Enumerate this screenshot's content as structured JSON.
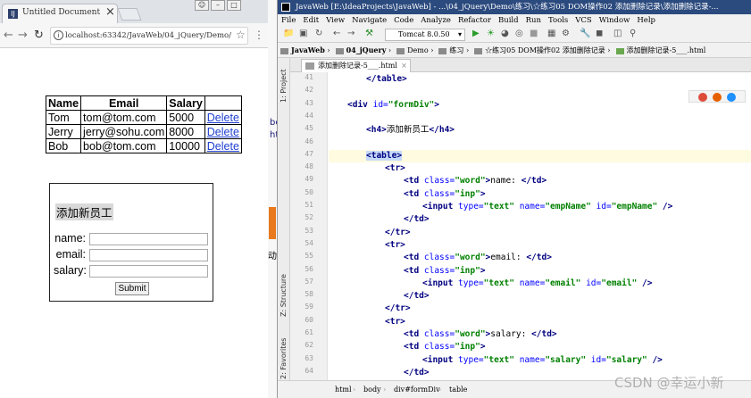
{
  "browser": {
    "tab_title": "Untitled Document",
    "tab_close": "×",
    "url": "localhost:63342/JavaWeb/04_jQuery/Demo/",
    "info_icon": "i",
    "table": {
      "headers": [
        "Name",
        "Email",
        "Salary",
        ""
      ],
      "rows": [
        [
          "Tom",
          "tom@tom.com",
          "5000",
          "Delete"
        ],
        [
          "Jerry",
          "jerry@sohu.com",
          "8000",
          "Delete"
        ],
        [
          "Bob",
          "bob@tom.com",
          "10000",
          "Delete"
        ]
      ]
    },
    "form": {
      "title": "添加新员工",
      "name_label": "name:",
      "email_label": "email:",
      "salary_label": "salary:",
      "submit_label": "Submit"
    }
  },
  "between_fragments": [
    "bc",
    "ht",
    "动"
  ],
  "ide": {
    "title": "JavaWeb [E:\\IdeaProjects\\JavaWeb] - ...\\04_jQuery\\Demo\\练习\\☆练习05 DOM操作02 添加删除记录\\添加删除记录-...",
    "menu": [
      "File",
      "Edit",
      "View",
      "Navigate",
      "Code",
      "Analyze",
      "Refactor",
      "Build",
      "Run",
      "Tools",
      "VCS",
      "Window",
      "Help"
    ],
    "run_config": "Tomcat 8.0.50",
    "breadcrumbs": [
      "JavaWeb",
      "04_jQuery",
      "Demo",
      "练习",
      "☆练习05 DOM操作02 添加删除记录",
      "添加删除记录-5___.html"
    ],
    "file_tab": "添加删除记录-5___.html",
    "side_labels": [
      "1: Project",
      "Z: Structure",
      "2: Favorites"
    ],
    "status_path": [
      "html",
      "body",
      "div#formDiv",
      "table"
    ],
    "code_lines": [
      {
        "n": "41",
        "indent": 2,
        "tokens": [
          {
            "c": "tag",
            "t": "</table>"
          }
        ]
      },
      {
        "n": "42",
        "indent": 0,
        "tokens": []
      },
      {
        "n": "43",
        "indent": 1,
        "tokens": [
          {
            "c": "tag",
            "t": "<div "
          },
          {
            "c": "at",
            "t": "id="
          },
          {
            "c": "av",
            "t": "\"formDiv\""
          },
          {
            "c": "tag",
            "t": ">"
          }
        ]
      },
      {
        "n": "44",
        "indent": 0,
        "tokens": []
      },
      {
        "n": "45",
        "indent": 2,
        "tokens": [
          {
            "c": "tag",
            "t": "<h4>"
          },
          {
            "c": "tx",
            "t": "添加新员工"
          },
          {
            "c": "tag",
            "t": "</h4>"
          }
        ]
      },
      {
        "n": "46",
        "indent": 0,
        "tokens": []
      },
      {
        "n": "47",
        "indent": 2,
        "tokens": [
          {
            "c": "tag sel",
            "t": "<table>"
          }
        ]
      },
      {
        "n": "48",
        "indent": 3,
        "tokens": [
          {
            "c": "tag",
            "t": "<tr>"
          }
        ]
      },
      {
        "n": "49",
        "indent": 4,
        "tokens": [
          {
            "c": "tag",
            "t": "<td "
          },
          {
            "c": "at",
            "t": "class="
          },
          {
            "c": "av",
            "t": "\"word\""
          },
          {
            "c": "tag",
            "t": ">"
          },
          {
            "c": "tx",
            "t": "name: "
          },
          {
            "c": "tag",
            "t": "</td>"
          }
        ]
      },
      {
        "n": "50",
        "indent": 4,
        "tokens": [
          {
            "c": "tag",
            "t": "<td "
          },
          {
            "c": "at",
            "t": "class="
          },
          {
            "c": "av",
            "t": "\"inp\""
          },
          {
            "c": "tag",
            "t": ">"
          }
        ]
      },
      {
        "n": "51",
        "indent": 5,
        "tokens": [
          {
            "c": "tag",
            "t": "<input "
          },
          {
            "c": "at",
            "t": "type="
          },
          {
            "c": "av",
            "t": "\"text\" "
          },
          {
            "c": "at",
            "t": "name="
          },
          {
            "c": "av",
            "t": "\"empName\" "
          },
          {
            "c": "at",
            "t": "id="
          },
          {
            "c": "av",
            "t": "\"empName\" "
          },
          {
            "c": "tag",
            "t": "/>"
          }
        ]
      },
      {
        "n": "52",
        "indent": 4,
        "tokens": [
          {
            "c": "tag",
            "t": "</td>"
          }
        ]
      },
      {
        "n": "53",
        "indent": 3,
        "tokens": [
          {
            "c": "tag",
            "t": "</tr>"
          }
        ]
      },
      {
        "n": "54",
        "indent": 3,
        "tokens": [
          {
            "c": "tag",
            "t": "<tr>"
          }
        ]
      },
      {
        "n": "55",
        "indent": 4,
        "tokens": [
          {
            "c": "tag",
            "t": "<td "
          },
          {
            "c": "at",
            "t": "class="
          },
          {
            "c": "av",
            "t": "\"word\""
          },
          {
            "c": "tag",
            "t": ">"
          },
          {
            "c": "tx",
            "t": "email: "
          },
          {
            "c": "tag",
            "t": "</td>"
          }
        ]
      },
      {
        "n": "56",
        "indent": 4,
        "tokens": [
          {
            "c": "tag",
            "t": "<td "
          },
          {
            "c": "at",
            "t": "class="
          },
          {
            "c": "av",
            "t": "\"inp\""
          },
          {
            "c": "tag",
            "t": ">"
          }
        ]
      },
      {
        "n": "57",
        "indent": 5,
        "tokens": [
          {
            "c": "tag",
            "t": "<input "
          },
          {
            "c": "at",
            "t": "type="
          },
          {
            "c": "av",
            "t": "\"text\" "
          },
          {
            "c": "at",
            "t": "name="
          },
          {
            "c": "av",
            "t": "\"email\" "
          },
          {
            "c": "at",
            "t": "id="
          },
          {
            "c": "av",
            "t": "\"email\" "
          },
          {
            "c": "tag",
            "t": "/>"
          }
        ]
      },
      {
        "n": "58",
        "indent": 4,
        "tokens": [
          {
            "c": "tag",
            "t": "</td>"
          }
        ]
      },
      {
        "n": "59",
        "indent": 3,
        "tokens": [
          {
            "c": "tag",
            "t": "</tr>"
          }
        ]
      },
      {
        "n": "60",
        "indent": 3,
        "tokens": [
          {
            "c": "tag",
            "t": "<tr>"
          }
        ]
      },
      {
        "n": "61",
        "indent": 4,
        "tokens": [
          {
            "c": "tag",
            "t": "<td "
          },
          {
            "c": "at",
            "t": "class="
          },
          {
            "c": "av",
            "t": "\"word\""
          },
          {
            "c": "tag",
            "t": ">"
          },
          {
            "c": "tx",
            "t": "salary: "
          },
          {
            "c": "tag",
            "t": "</td>"
          }
        ]
      },
      {
        "n": "62",
        "indent": 4,
        "tokens": [
          {
            "c": "tag",
            "t": "<td "
          },
          {
            "c": "at",
            "t": "class="
          },
          {
            "c": "av",
            "t": "\"inp\""
          },
          {
            "c": "tag",
            "t": ">"
          }
        ]
      },
      {
        "n": "63",
        "indent": 5,
        "tokens": [
          {
            "c": "tag",
            "t": "<input "
          },
          {
            "c": "at",
            "t": "type="
          },
          {
            "c": "av",
            "t": "\"text\" "
          },
          {
            "c": "at",
            "t": "name="
          },
          {
            "c": "av",
            "t": "\"salary\" "
          },
          {
            "c": "at",
            "t": "id="
          },
          {
            "c": "av",
            "t": "\"salary\" "
          },
          {
            "c": "tag",
            "t": "/>"
          }
        ]
      },
      {
        "n": "64",
        "indent": 4,
        "tokens": [
          {
            "c": "tag",
            "t": "</td>"
          }
        ]
      },
      {
        "n": "65",
        "indent": 3,
        "tokens": [
          {
            "c": "tag",
            "t": "</tr>"
          }
        ]
      }
    ]
  },
  "watermark": "CSDN @幸运小新",
  "colors": {
    "ide_title_bg": "#2b4a7e",
    "link": "#1f3fd0",
    "tag": "#000080",
    "attr": "#0000ff",
    "value": "#008000"
  }
}
